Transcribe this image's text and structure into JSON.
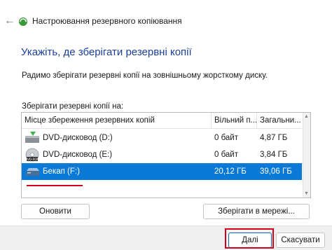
{
  "window": {
    "title": "Настроювання резервного копіювання",
    "back_icon": "arrow-left-icon",
    "app_icon": "backup-icon"
  },
  "heading": "Укажіть, де зберігати резервні копії",
  "recommendation": "Радимо зберігати резервні копії на зовнішньому жорсткому диску.",
  "list_label": "Зберігати резервні копії на:",
  "table": {
    "columns": [
      "Місце збереження резервних копій",
      "Вільний п...",
      "Загальни..."
    ],
    "rows": [
      {
        "name": "DVD-дисковод (D:)",
        "free": "0 байт",
        "total": "4,87 ГБ",
        "icon": "dvd-drive-icon",
        "selected": false
      },
      {
        "name": "DVD-дисковод (E:)",
        "free": "0 байт",
        "total": "3,84 ГБ",
        "icon": "dvd-rom-icon",
        "selected": false
      },
      {
        "name": "Бекап (F:)",
        "free": "20,12 ГБ",
        "total": "39,06 ГБ",
        "icon": "external-drive-icon",
        "selected": true
      }
    ]
  },
  "buttons": {
    "refresh": "Оновити",
    "save_network": "Зберігати в мережі...",
    "next": "Далі",
    "cancel": "Скасувати"
  },
  "colors": {
    "heading": "#1a3f9a",
    "selection": "#0a7ad6",
    "highlight": "#d0021b"
  }
}
